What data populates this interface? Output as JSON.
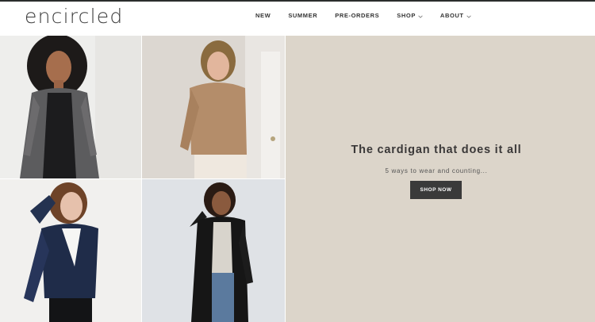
{
  "brand": {
    "logo_text": "encircled"
  },
  "nav": {
    "items": [
      {
        "label": "NEW"
      },
      {
        "label": "SUMMER"
      },
      {
        "label": "PRE-ORDERS"
      },
      {
        "label": "SHOP"
      },
      {
        "label": "ABOUT"
      }
    ]
  },
  "hero": {
    "headline": "The cardigan that does it all",
    "subheadline": "5 ways to wear and counting...",
    "cta_label": "SHOP NOW"
  },
  "colors": {
    "panel_bg": "#dcd5ca",
    "cta_bg": "#3a3a3a",
    "top_strip": "#2a2d2c"
  }
}
